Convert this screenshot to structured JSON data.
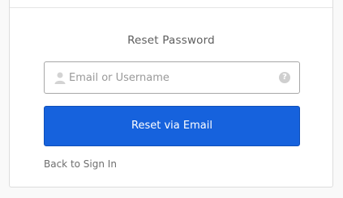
{
  "form": {
    "title": "Reset Password",
    "username_placeholder": "Email or Username",
    "username_value": "",
    "help_icon_glyph": "?",
    "submit_label": "Reset via Email",
    "back_link_label": "Back to Sign In"
  },
  "colors": {
    "primary_button": "#1662dd",
    "page_background": "#f9f9f9",
    "card_background": "#ffffff"
  },
  "icons": {
    "input_prefix": "user-icon",
    "input_suffix": "help-icon"
  }
}
